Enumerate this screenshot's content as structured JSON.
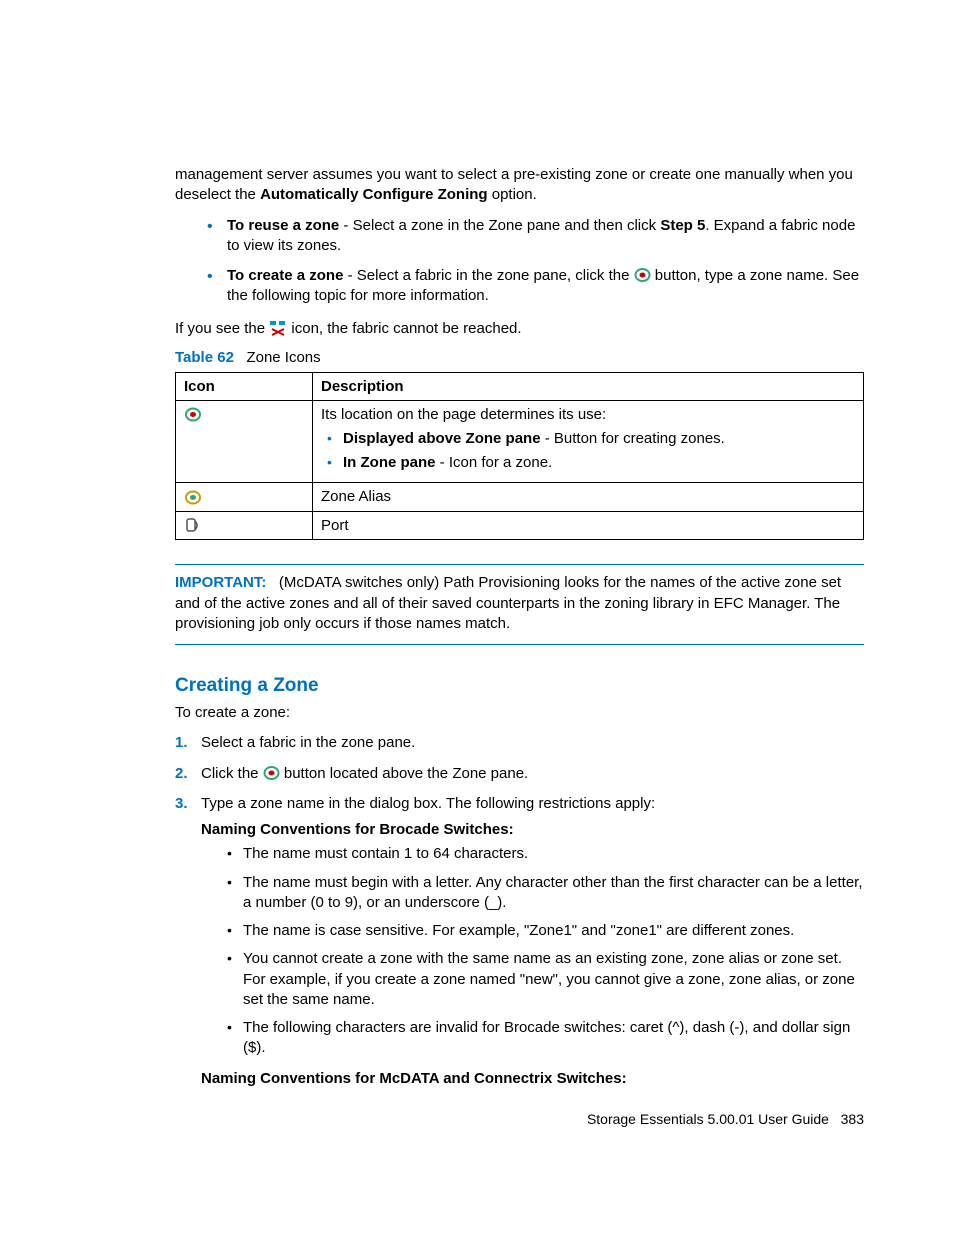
{
  "intro": {
    "p1_a": "management server assumes you want to select a pre-existing zone or create one manually when you deselect the ",
    "p1_bold": "Automatically Configure Zoning",
    "p1_b": " option."
  },
  "reuse": {
    "label": "To reuse a zone",
    "mid_a": "  -  Select a zone in the Zone pane and then click ",
    "step5": "Step 5",
    "mid_b": ". Expand a fabric node to view its zones."
  },
  "create": {
    "label": "To create a zone",
    "mid_a": " - Select a fabric in the zone pane, click the ",
    "mid_b": " button, type a zone name. See the following topic for more information."
  },
  "unreachable": {
    "a": "If you see the ",
    "b": " icon, the fabric cannot be reached."
  },
  "table": {
    "caption_label": "Table 62",
    "caption_text": "Zone Icons",
    "head_icon": "Icon",
    "head_desc": "Description",
    "row1": {
      "line1": "Its location on the page determines its use:",
      "b1_bold": "Displayed above Zone pane",
      "b1_rest": " - Button for creating zones.",
      "b2_bold": "In Zone pane",
      "b2_rest": " - Icon for a zone."
    },
    "row2": "Zone Alias",
    "row3": "Port"
  },
  "important": {
    "label": "IMPORTANT:",
    "text": "(McDATA switches only) Path Provisioning looks for the names of the active zone set and of the active zones and all of their saved counterparts in the zoning library in EFC Manager. The provisioning job only occurs if those names match."
  },
  "section": {
    "heading": "Creating a Zone",
    "intro": "To create a zone:",
    "step1": "Select a fabric in the zone pane.",
    "step2_a": "Click the ",
    "step2_b": " button located above the Zone pane.",
    "step3": "Type a zone name in the dialog box. The following restrictions apply:",
    "brocade_head": "Naming Conventions for Brocade Switches",
    "colon": ":",
    "brocade": {
      "b1": "The name must contain 1 to 64 characters.",
      "b2": "The name must begin with a letter. Any character other than the first character can be a letter, a number (0 to 9), or an underscore (_).",
      "b3": "The name is case sensitive. For example, \"Zone1\" and \"zone1\" are different zones.",
      "b4": "You cannot create a zone with the same name as an existing zone, zone alias or zone set. For example, if you create a zone named \"new\", you cannot give a zone, zone alias, or zone set the same name.",
      "b5": "The following characters are invalid for Brocade switches: caret (^), dash (-), and dollar sign ($)."
    },
    "mcdata_head": "Naming Conventions for McDATA and Connectrix Switches"
  },
  "footer": {
    "text": "Storage Essentials 5.00.01 User Guide",
    "page": "383"
  }
}
